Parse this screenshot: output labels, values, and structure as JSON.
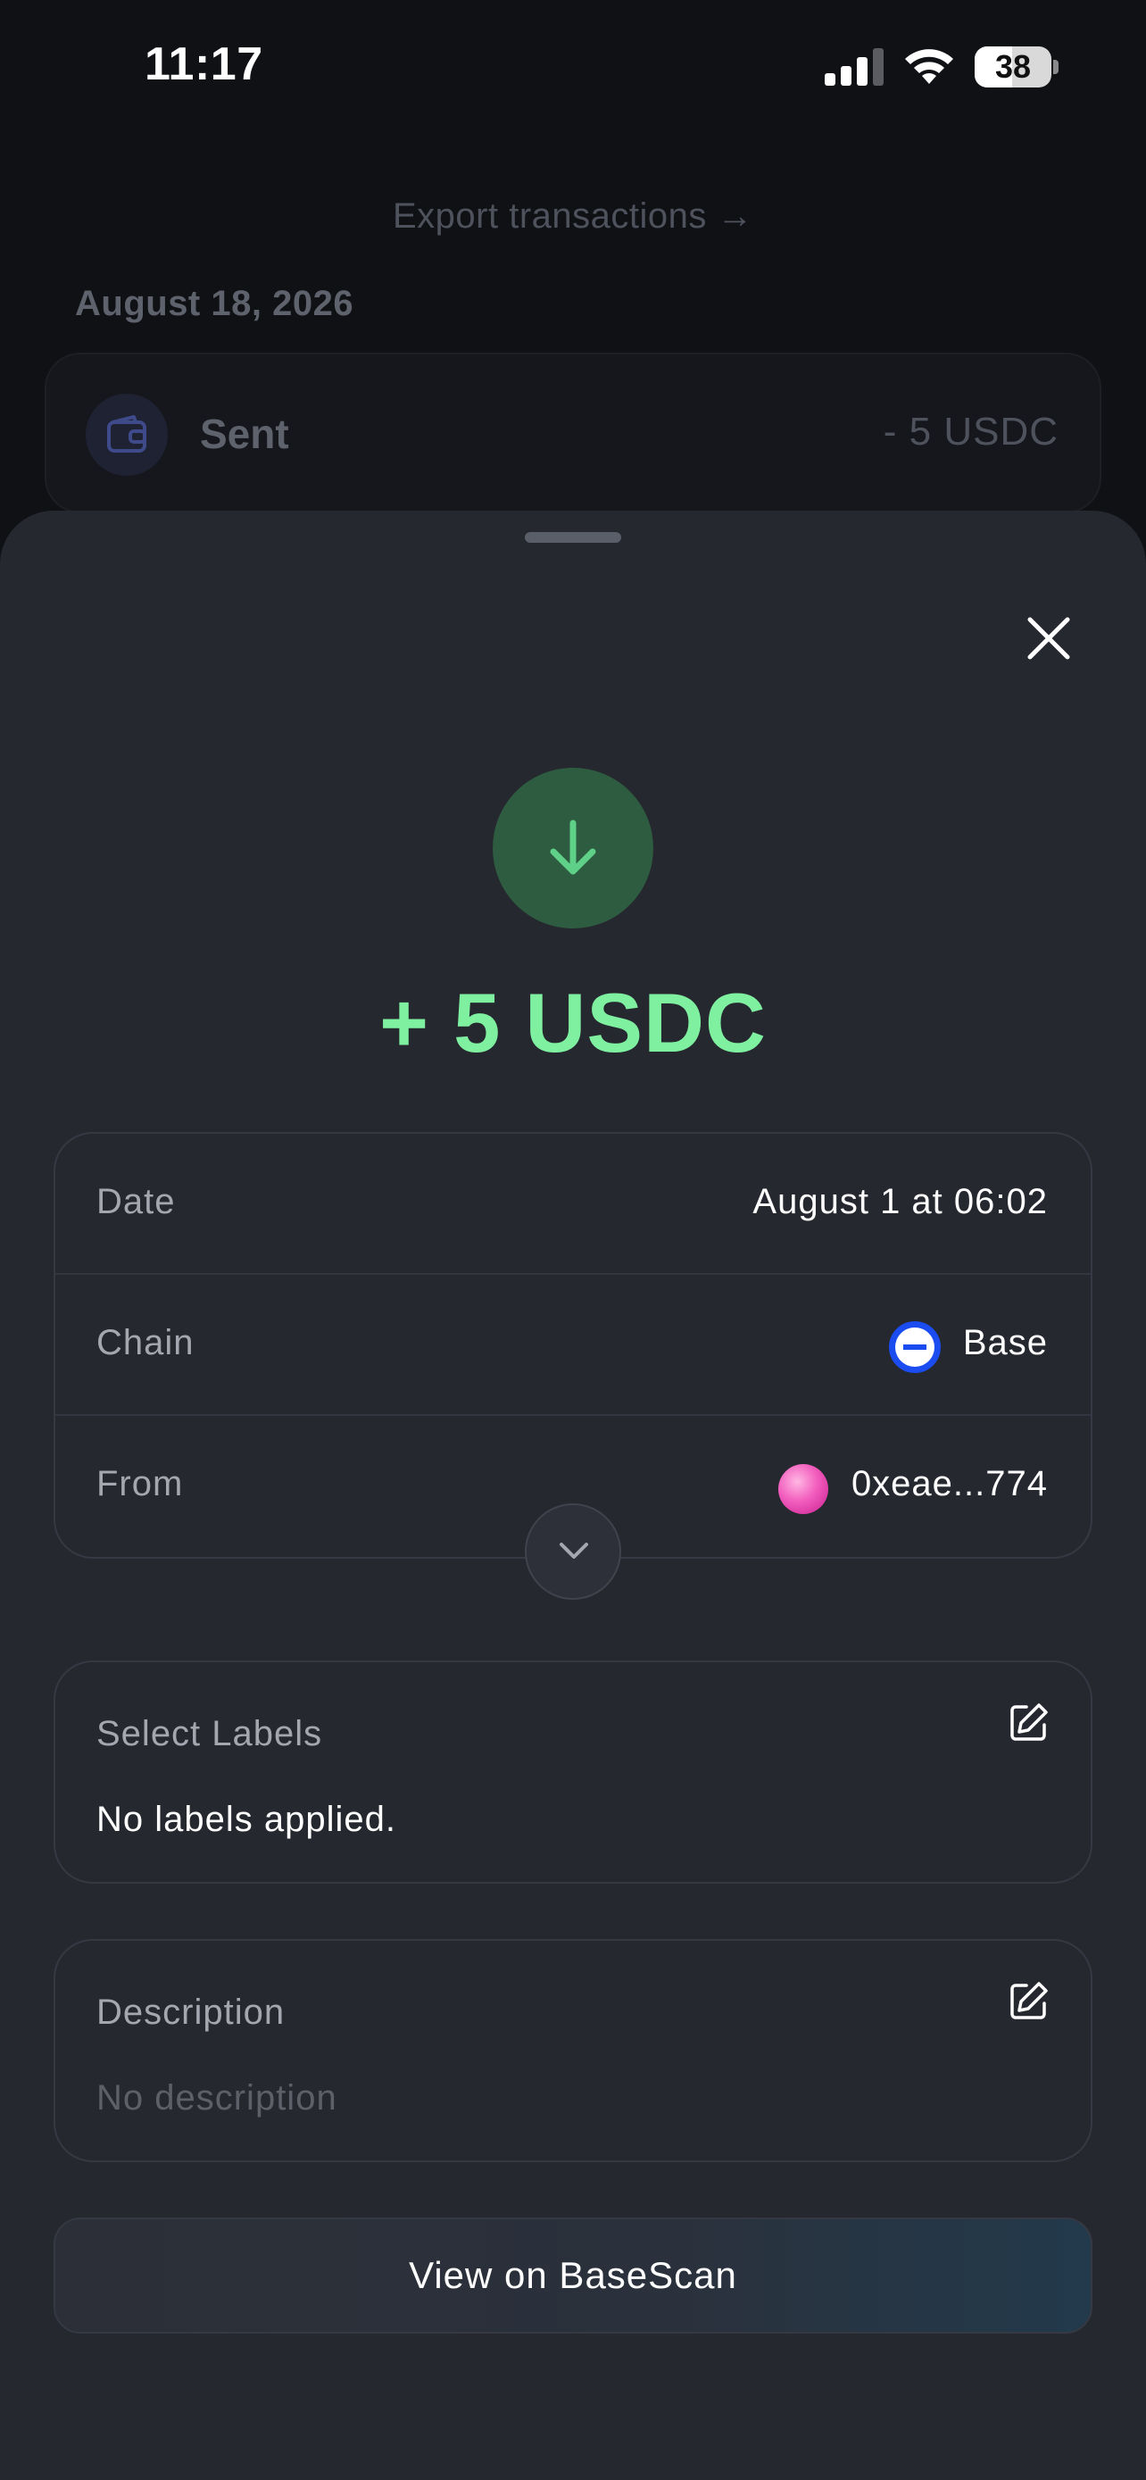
{
  "status_bar": {
    "time": "11:17",
    "battery_level": "38"
  },
  "background": {
    "export_link": "Export transactions →",
    "date_header": "August 18, 2026",
    "transaction": {
      "label": "Sent",
      "amount": "- 5 USDC",
      "icon": "wallet-icon"
    }
  },
  "sheet": {
    "amount": "+ 5 USDC",
    "direction_icon": "arrow-down-icon",
    "accent_color": "#7ff0a0",
    "details": {
      "date": {
        "label": "Date",
        "value": "August 1 at 06:02"
      },
      "chain": {
        "label": "Chain",
        "value": "Base",
        "logo": "base-logo-icon"
      },
      "from": {
        "label": "From",
        "value": "0xeae...774",
        "avatar": "wallet-avatar"
      }
    },
    "labels": {
      "title": "Select Labels",
      "body": "No labels applied."
    },
    "description": {
      "title": "Description",
      "body": "No description"
    },
    "explorer_button": "View on BaseScan"
  }
}
